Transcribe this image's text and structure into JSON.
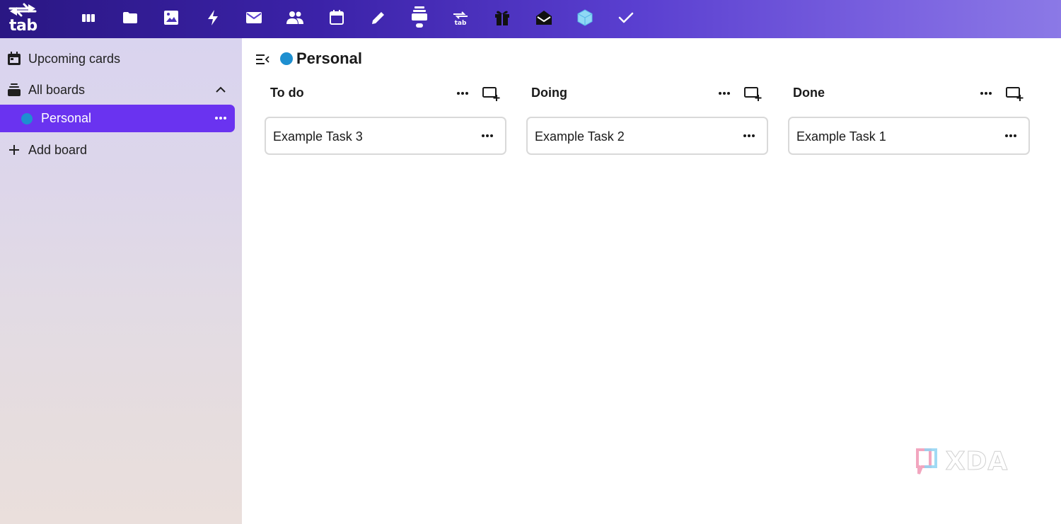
{
  "app": {
    "logo_text": "tab",
    "toolbar_icons": [
      "boards-icon",
      "folder-icon",
      "image-icon",
      "bolt-icon",
      "mail-icon",
      "people-icon",
      "calendar-icon",
      "pencil-icon",
      "stack-icon",
      "tab-swap-icon",
      "gift-icon",
      "mail-open-icon",
      "cube-icon",
      "check-icon"
    ]
  },
  "sidebar": {
    "upcoming_label": "Upcoming cards",
    "all_boards_label": "All boards",
    "active_board": {
      "label": "Personal",
      "color": "#1e8fd0"
    },
    "add_board_label": "Add board",
    "active_bg": "#6a33f0"
  },
  "board": {
    "title": "Personal",
    "color": "#1e8fd0",
    "columns": [
      {
        "title": "To do",
        "cards": [
          {
            "title": "Example Task 3"
          }
        ]
      },
      {
        "title": "Doing",
        "cards": [
          {
            "title": "Example Task 2"
          }
        ]
      },
      {
        "title": "Done",
        "cards": [
          {
            "title": "Example Task 1"
          }
        ]
      }
    ]
  },
  "watermark": {
    "text": "XDA"
  }
}
